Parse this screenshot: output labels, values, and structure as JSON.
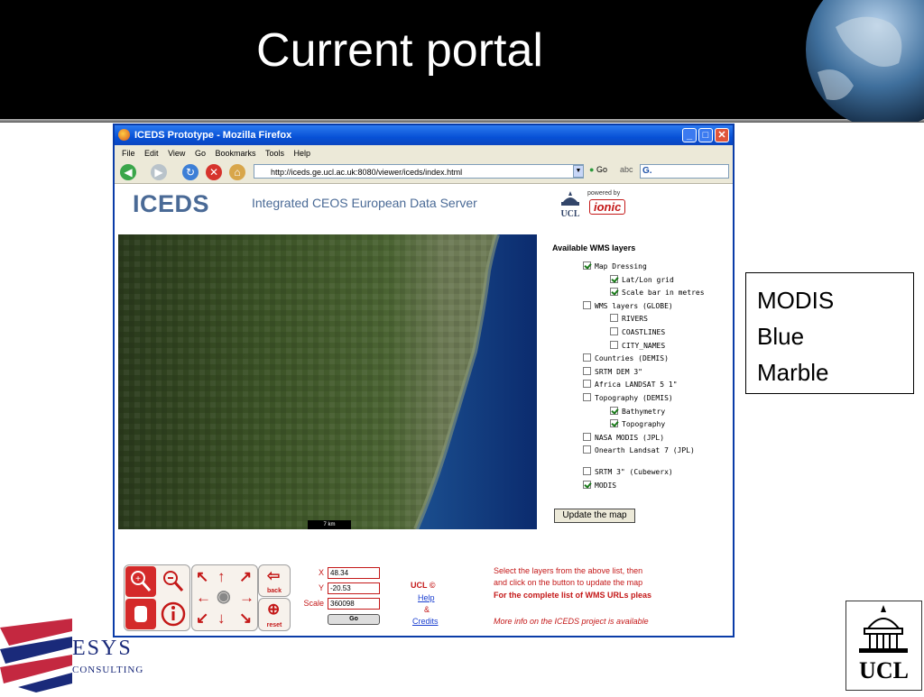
{
  "slide": {
    "title": "Current portal",
    "side_box_lines": [
      "MODIS",
      "Blue",
      "Marble"
    ],
    "footer_left_logo": {
      "name": "ESYS",
      "sub": "CONSULTING"
    },
    "footer_right_logo": {
      "name": "UCL"
    }
  },
  "browser": {
    "window_title": "ICEDS Prototype - Mozilla Firefox",
    "menu": [
      "File",
      "Edit",
      "View",
      "Go",
      "Bookmarks",
      "Tools",
      "Help"
    ],
    "url": "http://iceds.ge.ucl.ac.uk:8080/viewer/iceds/index.html",
    "go_label": "Go",
    "search_glyph": "G."
  },
  "page": {
    "logo": "ICEDS",
    "subtitle": "Integrated CEOS European Data Server",
    "powered_by": "powered by",
    "ucl_small": "UCL",
    "ionic_logo": "ionic",
    "map_scale": "7 km",
    "layers_title": "Available WMS layers",
    "layers": [
      {
        "label": "Map Dressing",
        "checked": true,
        "indent": 1
      },
      {
        "label": "Lat/Lon grid",
        "checked": true,
        "indent": 2
      },
      {
        "label": "Scale bar in metres",
        "checked": true,
        "indent": 2
      },
      {
        "label": "WMS layers (GLOBE)",
        "checked": false,
        "indent": 1
      },
      {
        "label": "RIVERS",
        "checked": false,
        "indent": 2
      },
      {
        "label": "COASTLINES",
        "checked": false,
        "indent": 2
      },
      {
        "label": "CITY_NAMES",
        "checked": false,
        "indent": 2
      },
      {
        "label": "Countries (DEMIS)",
        "checked": false,
        "indent": 1
      },
      {
        "label": "SRTM DEM 3\"",
        "checked": false,
        "indent": 1
      },
      {
        "label": "Africa LANDSAT 5 1\"",
        "checked": false,
        "indent": 1
      },
      {
        "label": "Topography (DEMIS)",
        "checked": false,
        "indent": 1
      },
      {
        "label": "Bathymetry",
        "checked": true,
        "indent": 2
      },
      {
        "label": "Topography",
        "checked": true,
        "indent": 2
      },
      {
        "label": "NASA MODIS (JPL)",
        "checked": false,
        "indent": 1
      },
      {
        "label": "Onearth Landsat 7 (JPL)",
        "checked": false,
        "indent": 1
      },
      {
        "label": "SRTM 3\" (Cubewerx)",
        "checked": false,
        "indent": 1
      },
      {
        "label": "MODIS",
        "checked": true,
        "indent": 1
      }
    ],
    "update_button": "Update the map",
    "controls": {
      "back_label": "back",
      "reset_label": "reset",
      "x_label": "X",
      "y_label": "Y",
      "scale_label": "Scale",
      "x_value": "48.34",
      "y_value": "-20.53",
      "scale_value": "360098",
      "go_label": "Go"
    },
    "ucl_copyright": "UCL ©",
    "help_link": "Help",
    "amp": "&",
    "credits_link": "Credits",
    "info_line1": "Select the layers from the above list, then",
    "info_line2": "and click on the button to update the map",
    "info_line3": "For the complete list of WMS URLs pleas",
    "info_line4": "More info on the ICEDS project is available"
  }
}
